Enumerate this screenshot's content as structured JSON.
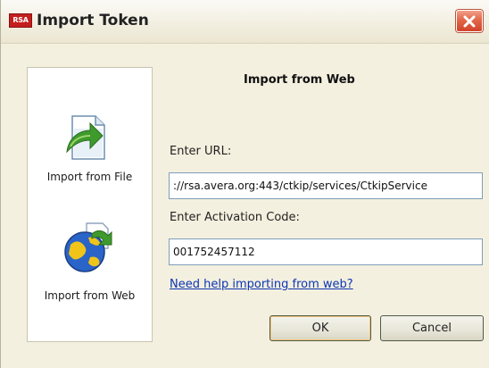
{
  "window": {
    "title": "Import Token",
    "logo_text": "RSA"
  },
  "left_panel": {
    "items": [
      {
        "label": "Import from File",
        "icon": "file-import-icon"
      },
      {
        "label": "Import from Web",
        "icon": "globe-import-icon"
      }
    ]
  },
  "main": {
    "section_title": "Import from Web",
    "url_label": "Enter URL:",
    "url_value": "://rsa.avera.org:443/ctkip/services/CtkipService",
    "activation_label": "Enter Activation Code:",
    "activation_value": "001752457112",
    "help_link": "Need help importing from web?"
  },
  "buttons": {
    "ok": "OK",
    "cancel": "Cancel"
  },
  "colors": {
    "dialog_bg": "#f4f0df",
    "link": "#0b35b5",
    "close_button": "#d2432a"
  }
}
